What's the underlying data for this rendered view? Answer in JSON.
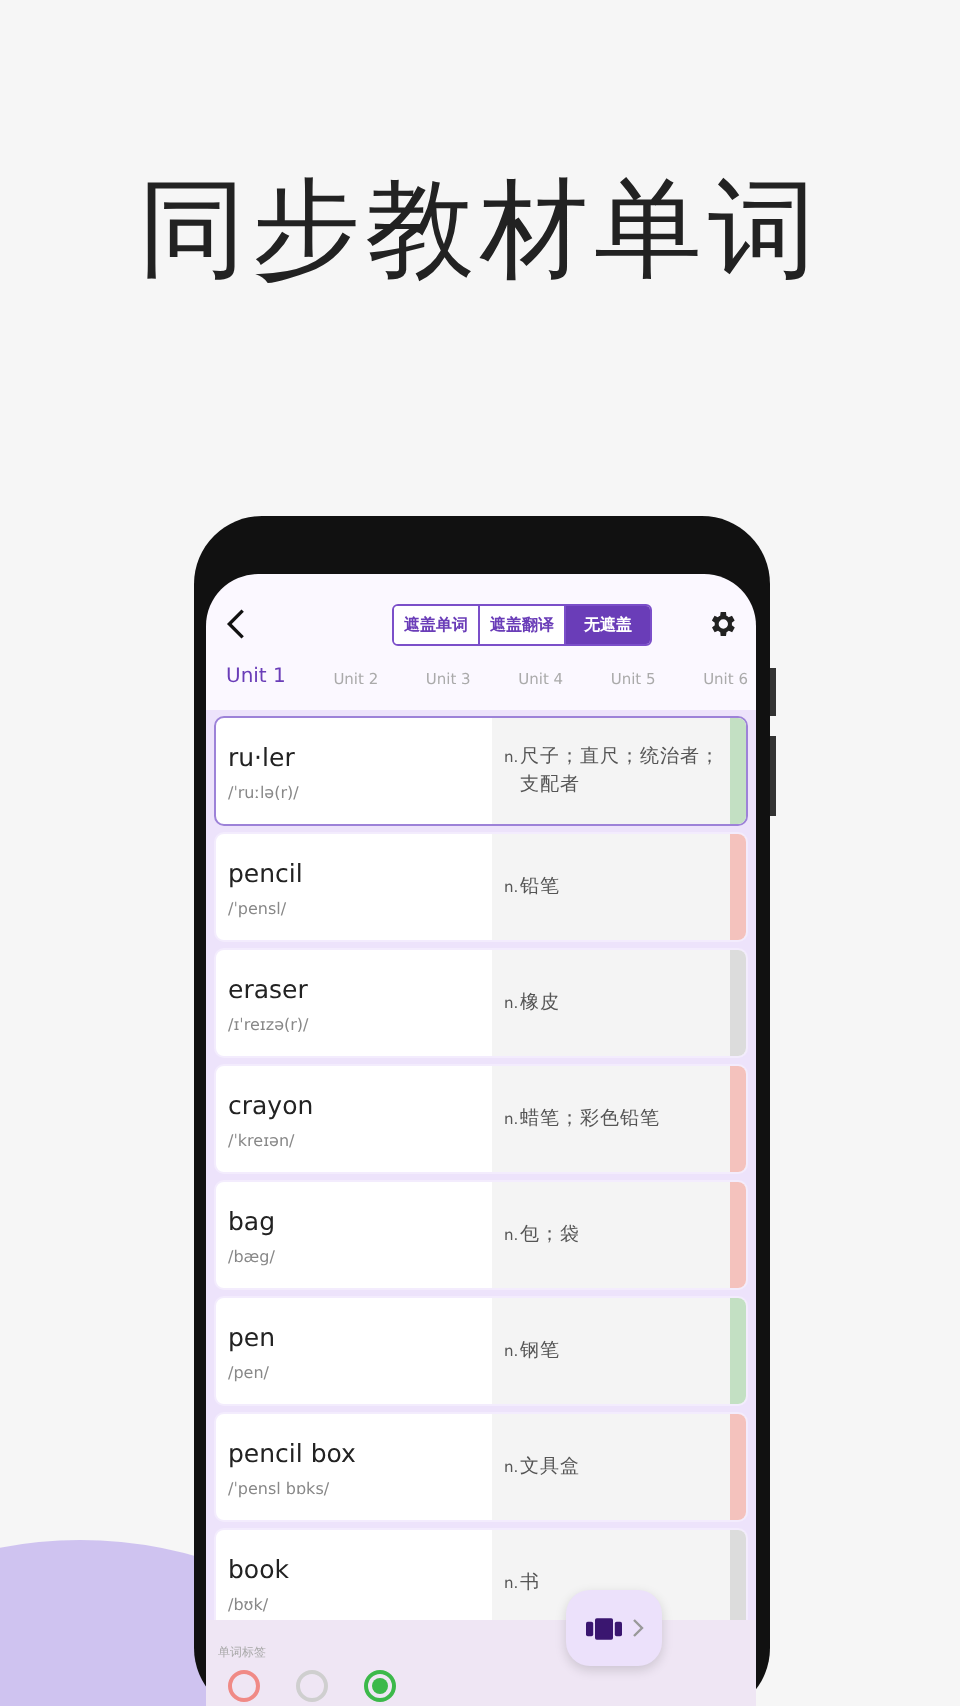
{
  "headline": "同步教材单词",
  "mask_modes": [
    {
      "label": "遮盖单词",
      "selected": false
    },
    {
      "label": "遮盖翻译",
      "selected": false
    },
    {
      "label": "无遮盖",
      "selected": true
    }
  ],
  "units": [
    {
      "label": "Unit 1",
      "selected": true
    },
    {
      "label": "Unit 2",
      "selected": false
    },
    {
      "label": "Unit 3",
      "selected": false
    },
    {
      "label": "Unit 4",
      "selected": false
    },
    {
      "label": "Unit 5",
      "selected": false
    },
    {
      "label": "Unit 6",
      "selected": false
    }
  ],
  "words": [
    {
      "word": "ru·ler",
      "phonetic": "/ˈruːlə(r)/",
      "pos": "n.",
      "meaning": "尺子；直尺；统治者；支配者",
      "color": "#c3e0c3",
      "selected": true
    },
    {
      "word": "pencil",
      "phonetic": "/ˈpensl/",
      "pos": "n.",
      "meaning": "铅笔",
      "color": "#f4c2bd",
      "selected": false
    },
    {
      "word": "eraser",
      "phonetic": "/ɪˈreɪzə(r)/",
      "pos": "n.",
      "meaning": "橡皮",
      "color": "#dcdcdc",
      "selected": false
    },
    {
      "word": "crayon",
      "phonetic": "/ˈkreɪən/",
      "pos": "n.",
      "meaning": "蜡笔；彩色铅笔",
      "color": "#f4c2bd",
      "selected": false
    },
    {
      "word": "bag",
      "phonetic": "/bæg/",
      "pos": "n.",
      "meaning": "包；袋",
      "color": "#f4c2bd",
      "selected": false
    },
    {
      "word": "pen",
      "phonetic": "/pen/",
      "pos": "n.",
      "meaning": "钢笔",
      "color": "#c3e0c3",
      "selected": false
    },
    {
      "word": "pencil box",
      "phonetic": "/ˈpensl bɒks/",
      "pos": "n.",
      "meaning": "文具盒",
      "color": "#f4c2bd",
      "selected": false
    },
    {
      "word": "book",
      "phonetic": "/bʊk/",
      "pos": "n.",
      "meaning": "书",
      "color": "#dcdcdc",
      "selected": false
    }
  ],
  "tag_bar": {
    "label": "单词标签",
    "tags": [
      {
        "color": "#f08a86",
        "selected": false
      },
      {
        "color": "#cfcfcf",
        "selected": false
      },
      {
        "color": "#3cb94a",
        "selected": true
      }
    ]
  }
}
